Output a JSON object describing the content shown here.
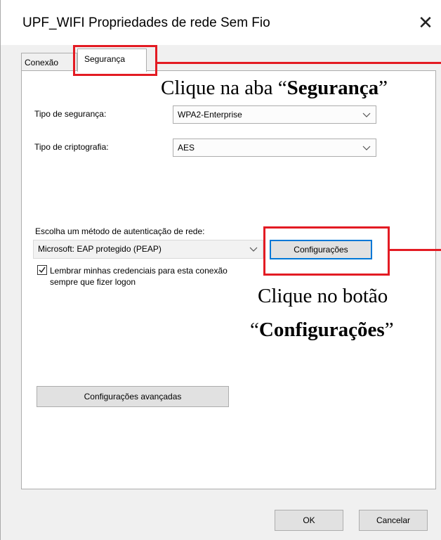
{
  "window": {
    "title": "UPF_WIFI Propriedades de rede Sem Fio",
    "close_glyph": "✕"
  },
  "tabs": [
    {
      "label": "Conexão",
      "selected": false
    },
    {
      "label": "Segurança",
      "selected": true
    }
  ],
  "security": {
    "type_label": "Tipo de segurança:",
    "type_value": "WPA2-Enterprise",
    "encryption_label": "Tipo de criptografia:",
    "encryption_value": "AES",
    "auth_label": "Escolha um método de autenticação de rede:",
    "auth_value": "Microsoft: EAP protegido (PEAP)",
    "settings_button": "Configurações",
    "remember_line1": "Lembrar minhas credenciais para esta conexão",
    "remember_line2": "sempre que fizer logon",
    "remember_checked": true,
    "advanced_button": "Configurações avançadas"
  },
  "footer": {
    "ok": "OK",
    "cancel": "Cancelar"
  },
  "annotations": {
    "tab_hint_prefix": "Clique na aba “",
    "tab_hint_bold": "Segurança",
    "tab_hint_suffix": "”",
    "button_hint_line1": "Clique no botão",
    "button_hint_prefix": "“",
    "button_hint_bold": "Configurações",
    "button_hint_suffix": "”"
  },
  "colors": {
    "highlight": "#e31b23",
    "focus_blue": "#0078d7"
  },
  "icons": [
    "close-icon",
    "chevron-down-icon",
    "checkmark-icon"
  ]
}
